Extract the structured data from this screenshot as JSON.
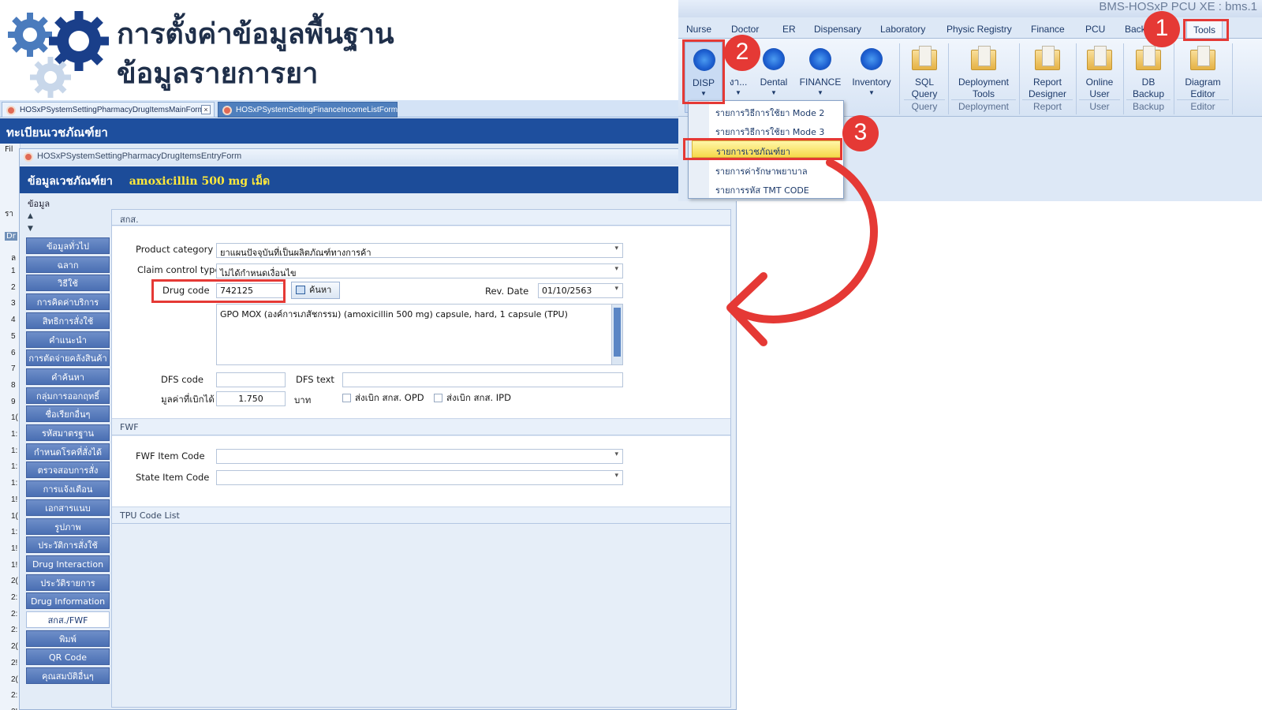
{
  "header": {
    "title_line1": "การตั้งค่าข้อมูลพื้นฐาน",
    "title_line2": "ข้อมูลรายการยา"
  },
  "doc_tabs": [
    "HOSxPSystemSettingPharmacyDrugItemsMainForm",
    "HOSxPSystemSettingFinanceIncomeListForm"
  ],
  "main_form": {
    "header": "ทะเบียนเวชภัณฑ์ยา",
    "left_grid": {
      "toolbar": "Fil",
      "col_a": "รา",
      "col_b": "Dr",
      "col_c": "ล",
      "rows": [
        "1",
        "2",
        "3",
        "4",
        "5",
        "6",
        "7",
        "8",
        "9",
        "1(",
        "1:",
        "1:",
        "1:",
        "1:",
        "1!",
        "1(",
        "1:",
        "1!",
        "1!",
        "2(",
        "2:",
        "2:",
        "2:",
        "2(",
        "2!",
        "2(",
        "2:",
        "2!"
      ]
    }
  },
  "entry_form": {
    "window_title": "HOSxPSystemSettingPharmacyDrugItemsEntryForm",
    "header_label": "ข้อมูลเวชภัณฑ์ยา",
    "drug_name": "amoxicillin 500 mg เม็ด",
    "menu": "ข้อมูล",
    "nav": [
      "ข้อมูลทั่วไป",
      "ฉลาก",
      "วิธีใช้",
      "การคิดค่าบริการ",
      "สิทธิการสั่งใช้",
      "คำแนะนำ",
      "การตัดจ่ายคลังสินค้า",
      "คำค้นหา",
      "กลุ่มการออกฤทธิ์",
      "ชื่อเรียกอื่นๆ",
      "รหัสมาตรฐาน",
      "กำหนดโรคที่สั่งได้",
      "ตรวจสอบการสั่ง",
      "การแจ้งเตือน",
      "เอกสารแนบ",
      "รูปภาพ",
      "ประวัติการสั่งใช้",
      "Drug Interaction",
      "ประวัติรายการ",
      "Drug Information",
      "สกส./FWF",
      "พิมพ์",
      "QR Code",
      "คุณสมบัติอื่นๆ"
    ],
    "active_nav": "สกส./FWF",
    "sec1": {
      "title": "สกส.",
      "product_category_label": "Product category",
      "product_category_value": "ยาแผนปัจจุบันที่เป็นผลิตภัณฑ์ทางการค้า",
      "claim_label": "Claim control type",
      "claim_value": "ไม่ได้กำหนดเงื่อนไข",
      "drug_code_label": "Drug code",
      "drug_code_value": "742125",
      "search_button": "ค้นหา",
      "rev_date_label": "Rev. Date",
      "rev_date_value": "01/10/2563",
      "memo": "GPO MOX (องค์การเภสัชกรรม) (amoxicillin 500 mg) capsule, hard, 1 capsule (TPU)",
      "dfs_code_label": "DFS code",
      "dfs_code_value": "",
      "dfs_text_label": "DFS text",
      "dfs_text_value": "",
      "claim_amount_label": "มูลค่าที่เบิกได้",
      "claim_amount_value": "1.750",
      "baht": "บาท",
      "opd_label": "ส่งเบิก สกส. OPD",
      "ipd_label": "ส่งเบิก สกส. IPD"
    },
    "sec2": {
      "title": "FWF",
      "fwf_label": "FWF Item Code",
      "state_label": "State Item Code"
    },
    "sec3": {
      "title": "TPU Code List"
    }
  },
  "ribbon": {
    "window_title": "BMS-HOSxP PCU XE : bms.1",
    "tabs": [
      "Nurse",
      "Doctor",
      "ER",
      "Dispensary",
      "Laboratory",
      "Physic Registry",
      "Finance",
      "PCU",
      "Back",
      "Tools"
    ],
    "active_tab": "Tools",
    "buttons": {
      "disp": "DISP",
      "ngan": "งา...",
      "dental": "Dental",
      "finance": "FINANCE",
      "inventory": "Inventory",
      "sql": "SQL\nQuery",
      "deployment": "Deployment\nTools",
      "report": "Report\nDesigner",
      "online": "Online\nUser",
      "backup": "DB\nBackup",
      "diagram": "Diagram\nEditor"
    },
    "groups": [
      "Query",
      "Deployment",
      "Report",
      "User",
      "Backup",
      "Editor"
    ]
  },
  "dropdown": {
    "items": [
      "รายการวิธีการใช้ยา Mode 2",
      "รายการวิธีการใช้ยา Mode 3",
      "รายการเวชภัณฑ์ยา",
      "รายการค่ารักษาพยาบาล",
      "รายการรหัส TMT CODE"
    ],
    "highlighted": "รายการเวชภัณฑ์ยา"
  },
  "callouts": [
    "1",
    "2",
    "3"
  ],
  "colors": {
    "accent_red": "#e53935",
    "header_blue": "#1c4c99",
    "drug_yellow": "#ffe93b"
  }
}
